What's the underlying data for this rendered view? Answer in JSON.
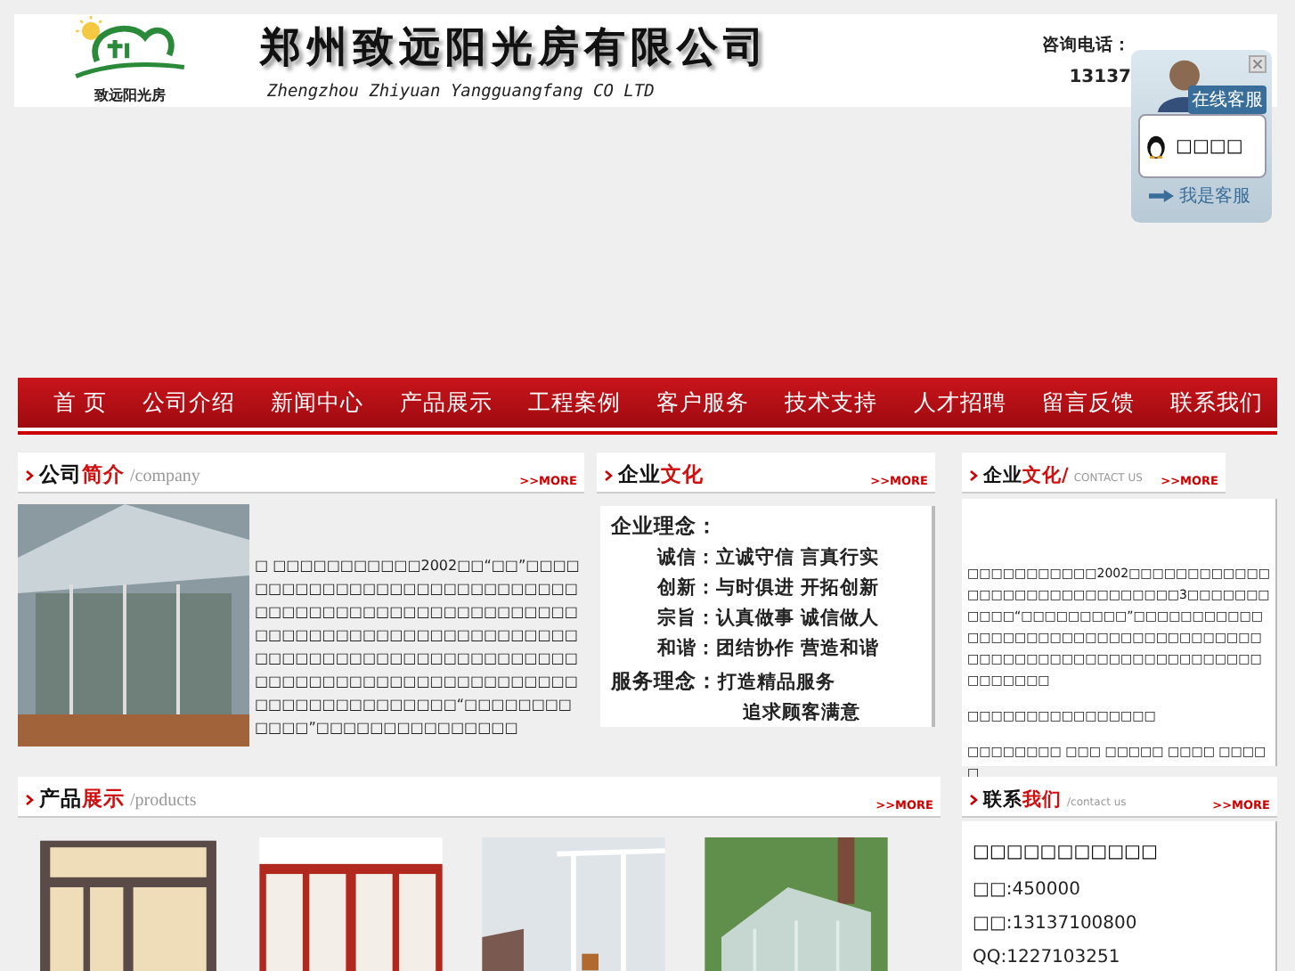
{
  "header": {
    "logo_text": "致远阳光房",
    "company_name": "郑州致远阳光房有限公司",
    "company_name_en": "Zhengzhou Zhiyuan Yangguangfang CO LTD",
    "phone_label": "咨询电话：",
    "phone": "13137"
  },
  "service_widget": {
    "badge": "在线客服",
    "contact": "□□□□",
    "link": "我是客服"
  },
  "nav": [
    "首 页",
    "公司介绍",
    "新闻中心",
    "产品展示",
    "工程案例",
    "客户服务",
    "技术支持",
    "人才招聘",
    "留言反馈",
    "联系我们"
  ],
  "about": {
    "title": "公司",
    "title_accent": "简介",
    "subtitle": "/company",
    "more": ">>MORE",
    "text": "□ □□□□□□□□□□□2002□□“□□”□□□□□□□□□□□□□□□□□□□□□□□□□□□□□□□□□□□□□□□□□□□□□□□□□□□□□□□□□□□□□□□□□□□□□□□□□□□□□□□□□□□□□□□□□□□□□□□□□□□□□□□□□□□□□□□□□□□□□□□□□□□□□□□□□□□□□□□□□□□“□□□□□□□□□□□□”□□□□□□□□□□□□□□□"
  },
  "culture": {
    "title": "企业",
    "title_accent": "文化",
    "more": ">>MORE",
    "heading": "企业理念：",
    "lines": [
      {
        "label": "诚信：",
        "text": "立诚守信 言真行实"
      },
      {
        "label": "创新：",
        "text": "与时俱进 开拓创新"
      },
      {
        "label": "宗旨：",
        "text": "认真做事 诚信做人"
      },
      {
        "label": "和谐：",
        "text": "团结协作 营造和谐"
      }
    ],
    "service_heading": "服务理念：",
    "service_lines": [
      "打造精品服务",
      "追求顾客满意"
    ]
  },
  "culture_side": {
    "title": "企业",
    "title_accent": "文化/",
    "subtitle": "CONTACT US",
    "more": ">>MORE",
    "paragraphs": [
      "□□□□□□□□□□□2002□□□□□□□□□□□□□□□□□□□□□□□□□□□□□□3□□□□□□□□□□□“□□□□□□□□□”□□□□□□□□□□□□□□□□□□□□□□□□□□□□□□□□□□□□□□□□□□□□□□□□□□□□□□□□□□□□□□□□□□□□",
      "□□□□□□□□□□□□□□□□",
      "□□□□□□□□ □□□ □□□□□ □□□□ □□□□□"
    ]
  },
  "products": {
    "title": "产品",
    "title_accent": "展示",
    "subtitle": "/products",
    "more": ">>MORE",
    "items": [
      {
        "kind": "door"
      },
      {
        "kind": "screen"
      },
      {
        "kind": "balcony"
      },
      {
        "kind": "sunroom"
      }
    ]
  },
  "contact": {
    "title": "联系",
    "title_accent": "我们",
    "subtitle": "/contact us",
    "more": ">>MORE",
    "name": "□□□□□□□□□□□",
    "lines": [
      "□□:450000",
      "□□:13137100800",
      "QQ:1227103251"
    ]
  }
}
